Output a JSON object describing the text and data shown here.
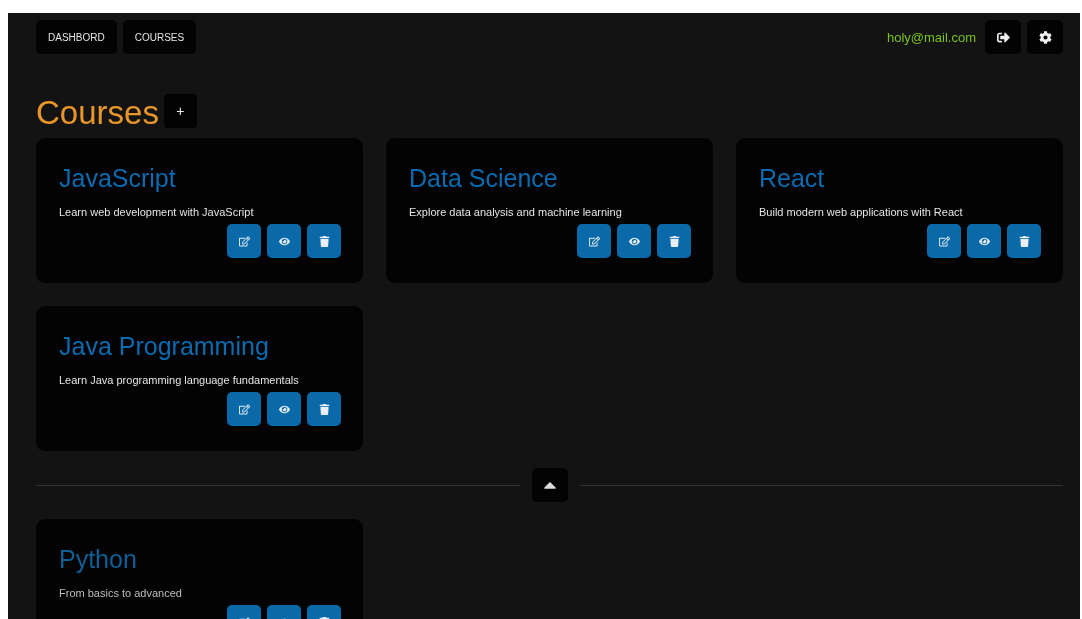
{
  "nav": [
    {
      "label": "DASHBORD"
    },
    {
      "label": "COURSES"
    }
  ],
  "user": {
    "email": "holy@mail.com"
  },
  "heading": {
    "title": "Courses",
    "add_label": "+"
  },
  "courses": [
    {
      "title": "JavaScript",
      "description": "Learn web development with JavaScript"
    },
    {
      "title": "Data Science",
      "description": "Explore data analysis and machine learning"
    },
    {
      "title": "React",
      "description": "Build modern web applications with React"
    },
    {
      "title": "Java Programming",
      "description": "Learn Java programming language fundamentals"
    }
  ],
  "section_toggle": {
    "expanded": true
  },
  "more_courses": [
    {
      "title": "Python",
      "description": "From basics to advanced"
    }
  ]
}
